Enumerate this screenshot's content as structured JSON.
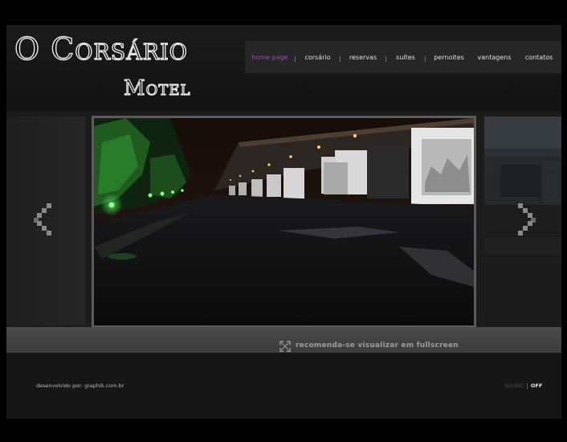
{
  "brand": {
    "line1": "O Corsário",
    "line2": "Motel"
  },
  "nav": {
    "items": [
      {
        "label": "home page",
        "active": true
      },
      {
        "label": "corsário",
        "active": false
      },
      {
        "label": "reservas",
        "active": false
      },
      {
        "label": "suítes",
        "active": false
      },
      {
        "label": "pernoites",
        "active": false
      },
      {
        "label": "vantagens",
        "active": false
      },
      {
        "label": "contatos",
        "active": false
      }
    ],
    "active_color": "#9a4bb8"
  },
  "slider": {
    "prev_icon": "chevron-left-icon",
    "next_icon": "chevron-right-icon",
    "photo_subject": "night view of motel garage entrances"
  },
  "fullscreen": {
    "icon": "fullscreen-icon",
    "text": "recomenda-se visualizar em fullscreen"
  },
  "footer": {
    "credit": "desenvolvido por: graphik.com.br",
    "sound_label": "SOUND",
    "sound_state": "OFF"
  }
}
